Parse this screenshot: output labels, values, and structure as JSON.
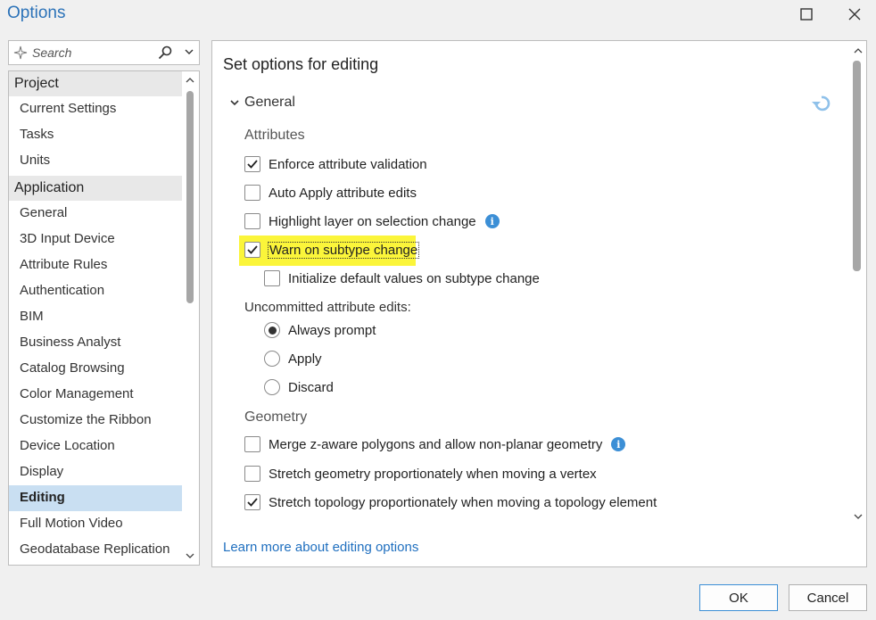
{
  "window": {
    "title": "Options"
  },
  "search": {
    "placeholder": "Search"
  },
  "nav": {
    "groups": [
      {
        "label": "Project",
        "items": [
          "Current Settings",
          "Tasks",
          "Units"
        ]
      },
      {
        "label": "Application",
        "items": [
          "General",
          "3D Input Device",
          "Attribute Rules",
          "Authentication",
          "BIM",
          "Business Analyst",
          "Catalog Browsing",
          "Color Management",
          "Customize the Ribbon",
          "Device Location",
          "Display",
          "Editing",
          "Full Motion Video",
          "Geodatabase Replication"
        ]
      }
    ],
    "selected": "Editing",
    "scroll_fraction_visible": 0.45
  },
  "panel": {
    "title": "Set options for editing",
    "section": "General",
    "attributes_label": "Attributes",
    "options": {
      "enforce_validation": {
        "label": "Enforce attribute validation",
        "checked": true
      },
      "auto_apply": {
        "label": "Auto Apply attribute edits",
        "checked": false
      },
      "highlight_layer": {
        "label": "Highlight layer on selection change",
        "checked": false
      },
      "warn_subtype": {
        "label": "Warn on subtype change",
        "checked": true
      },
      "init_defaults": {
        "label": "Initialize default values on subtype change",
        "checked": false
      }
    },
    "uncommitted_label": "Uncommitted attribute edits:",
    "radios": [
      "Always prompt",
      "Apply",
      "Discard"
    ],
    "radio_selected": "Always prompt",
    "geometry_label": "Geometry",
    "geometry_options": {
      "merge_z": {
        "label": "Merge z-aware polygons and allow non-planar geometry",
        "checked": false
      },
      "stretch_geometry": {
        "label": "Stretch geometry proportionately when moving a vertex",
        "checked": false
      },
      "stretch_topology": {
        "label": "Stretch topology proportionately when moving a topology element",
        "checked": true
      }
    },
    "learn_more": "Learn more about editing options"
  },
  "buttons": {
    "ok": "OK",
    "cancel": "Cancel"
  },
  "colors": {
    "accent": "#2b72b8",
    "selected_bg": "#c9dff2",
    "highlight": "#fbf53a",
    "link": "#1f6fbf"
  }
}
